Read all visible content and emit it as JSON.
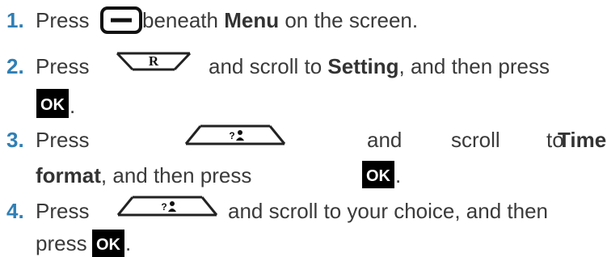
{
  "steps": [
    {
      "number": "1.",
      "press": "Press",
      "after_icon": " beneath ",
      "bold": "Menu",
      "rest": " on the screen.",
      "icon": "softkey-minus-icon"
    },
    {
      "number": "2.",
      "press": "Press",
      "after_icon": "and scroll to ",
      "bold": "Setting",
      "rest": ", and then press",
      "icon_key_label": "R",
      "ok_label": "OK",
      "trailing": "."
    },
    {
      "number": "3.",
      "press": "Press",
      "w_and": "and",
      "w_scroll": "scroll",
      "w_to": "to",
      "bold1": "Time",
      "bold2": "format",
      "rest": ", and then press",
      "ok_label": "OK",
      "trailing": "."
    },
    {
      "number": "4.",
      "press": "Press",
      "after_icon": "and scroll to your choice, and then",
      "line2": "press",
      "ok_label": "OK",
      "trailing": "."
    }
  ],
  "colors": {
    "number": "#2f7fb5",
    "text": "#3a3a3a",
    "ok_bg": "#000000"
  }
}
